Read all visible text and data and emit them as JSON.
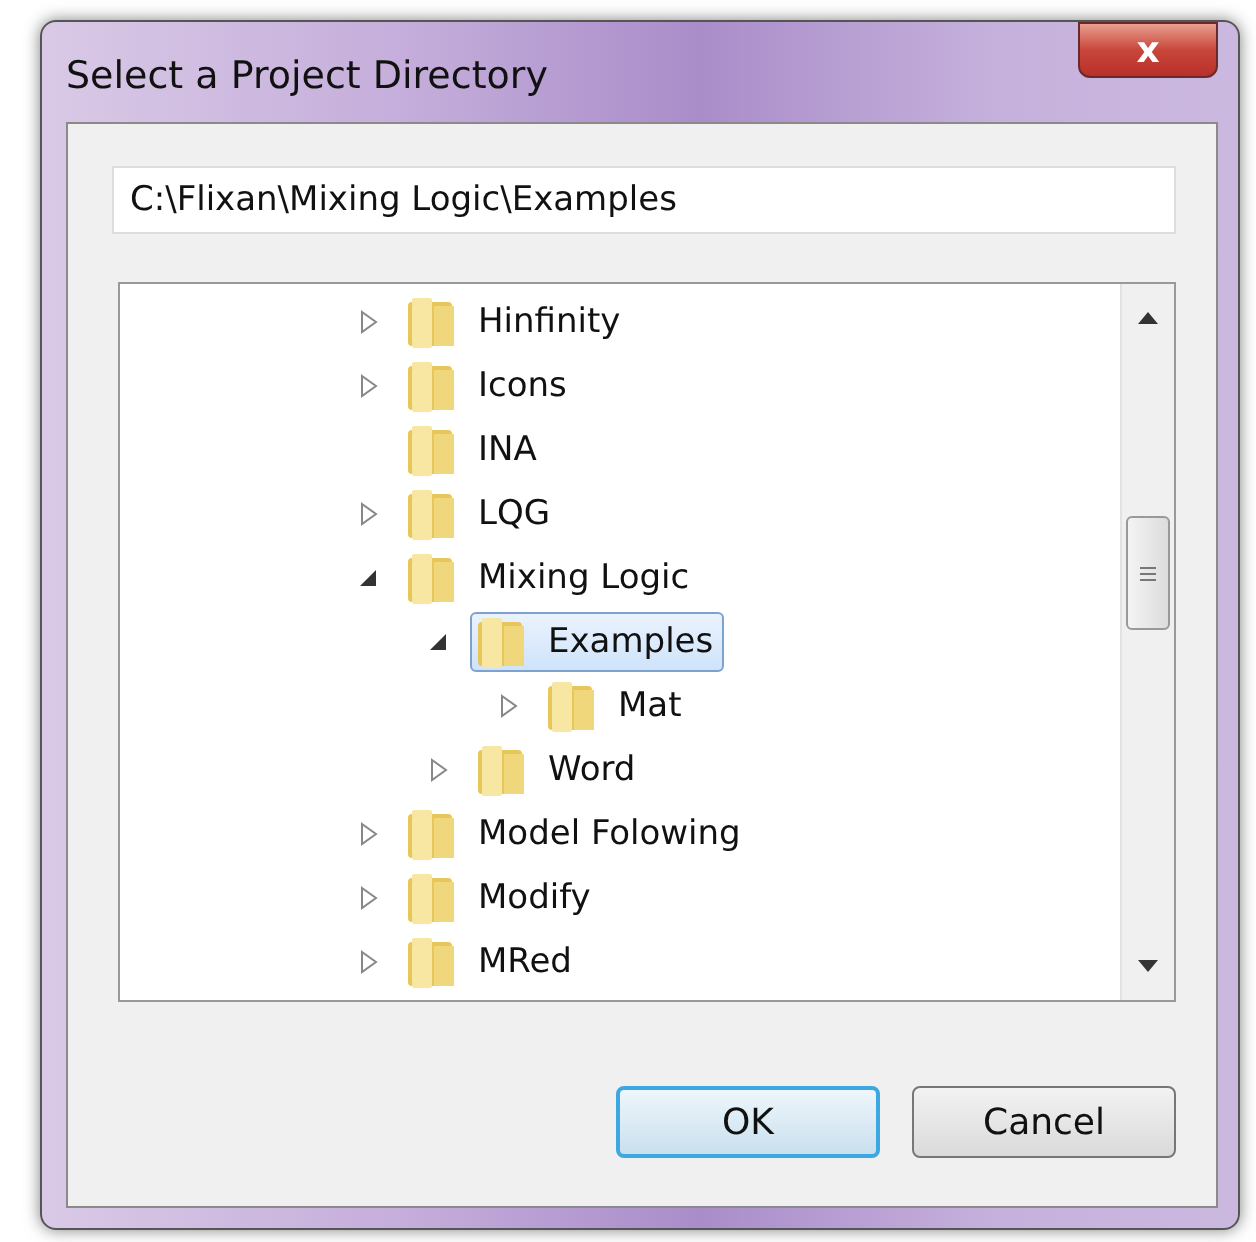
{
  "window": {
    "title": "Select a Project Directory",
    "close_label": "x"
  },
  "path_field": {
    "value": "C:\\Flixan\\Mixing Logic\\Examples"
  },
  "tree": [
    {
      "label": "Hinfinity",
      "expandable": true,
      "expanded": false,
      "selected": false
    },
    {
      "label": "Icons",
      "expandable": true,
      "expanded": false,
      "selected": false
    },
    {
      "label": "INA",
      "expandable": false,
      "selected": false
    },
    {
      "label": "LQG",
      "expandable": true,
      "expanded": false,
      "selected": false
    },
    {
      "label": "Mixing Logic",
      "expandable": true,
      "expanded": true,
      "selected": false,
      "children": [
        {
          "label": "Examples",
          "expandable": true,
          "expanded": true,
          "selected": true,
          "children": [
            {
              "label": "Mat",
              "expandable": true,
              "expanded": false,
              "selected": false
            }
          ]
        },
        {
          "label": "Word",
          "expandable": true,
          "expanded": false,
          "selected": false
        }
      ]
    },
    {
      "label": "Model Folowing",
      "expandable": true,
      "expanded": false,
      "selected": false
    },
    {
      "label": "Modify",
      "expandable": true,
      "expanded": false,
      "selected": false
    },
    {
      "label": "MRed",
      "expandable": true,
      "expanded": false,
      "selected": false
    }
  ],
  "buttons": [
    {
      "label": "OK",
      "default": true
    },
    {
      "label": "Cancel",
      "default": false
    }
  ]
}
